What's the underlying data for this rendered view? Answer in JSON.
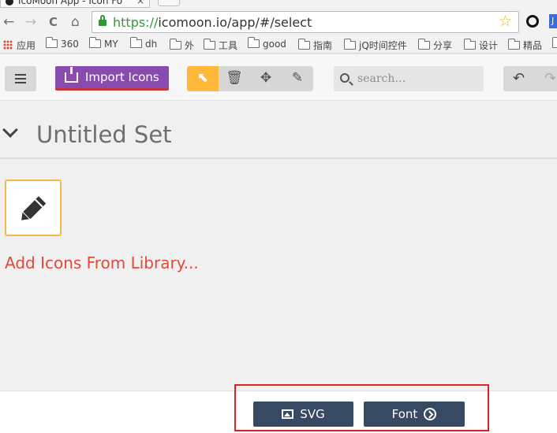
{
  "browser": {
    "tab_title": "IcoMoon App - Icon Fo",
    "tab_close": "×",
    "nav": {
      "back": "←",
      "forward": "→",
      "reload": "C",
      "home": "⌂"
    },
    "url_scheme": "https://",
    "url_rest": "icomoon.io/app/#/select",
    "star": "☆",
    "ext2_label": "J",
    "bookmarks": [
      "应用",
      "360",
      "MY",
      "dh",
      "外",
      "工具",
      "good",
      "指南",
      "jQ时间控件",
      "分享",
      "设计",
      "精品",
      "A"
    ]
  },
  "app": {
    "toolbar": {
      "import_label": "Import Icons",
      "search_placeholder": "search…",
      "tools": {
        "select": "⬉",
        "delete": "🗑",
        "move": "✥",
        "edit": "✎"
      },
      "undo": "↶",
      "redo": "↷"
    },
    "set": {
      "title": "Untitled Set",
      "add_link": "Add Icons From Library..."
    },
    "footer": {
      "svg_label": "SVG",
      "font_label": "Font"
    }
  },
  "colors": {
    "import_button": "#8a4bb0",
    "active_tool": "#ffb83a",
    "footer_button": "#384a63",
    "add_link": "#e04a3a",
    "annotation": "#e02020"
  }
}
